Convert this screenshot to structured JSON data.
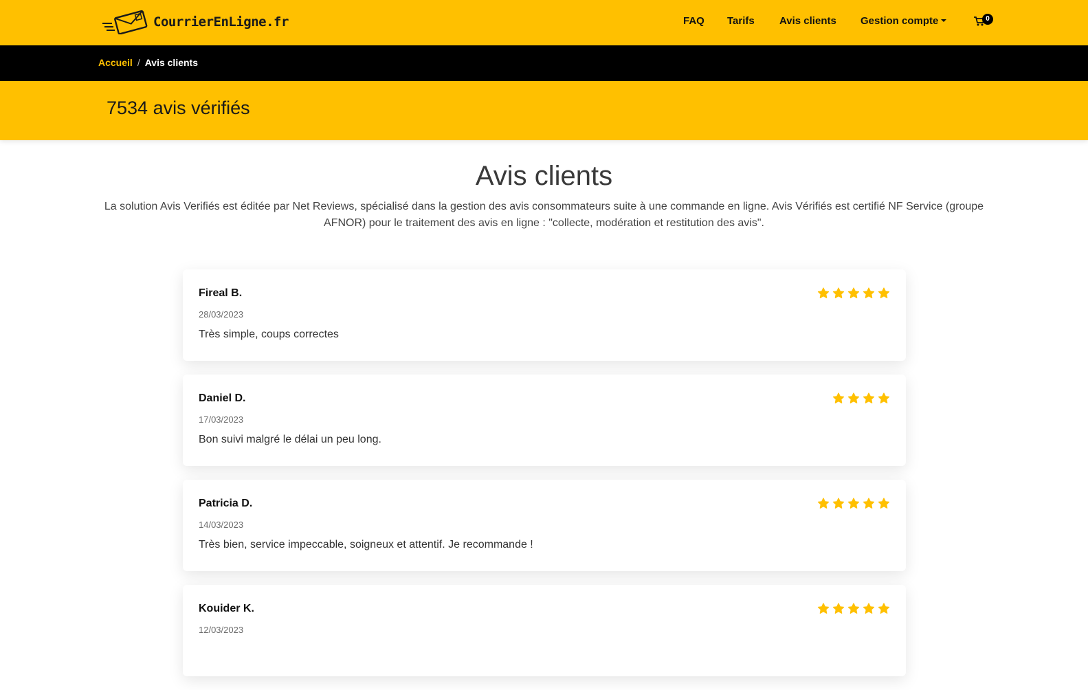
{
  "brand": {
    "name": "CourrierEnLigne.fr",
    "logo_icon": "envelope-icon"
  },
  "nav": {
    "items": [
      {
        "label": "FAQ"
      },
      {
        "label": "Tarifs"
      },
      {
        "label": "Avis clients"
      },
      {
        "label": "Gestion compte",
        "has_dropdown": true
      }
    ],
    "cart": {
      "icon": "cart-icon",
      "count": "0"
    }
  },
  "breadcrumb": {
    "home": "Accueil",
    "separator": "/",
    "current": "Avis clients"
  },
  "hero": {
    "title": "7534 avis vérifiés"
  },
  "page": {
    "title": "Avis clients",
    "intro": "La solution Avis Verifiés est éditée par Net Reviews, spécialisé dans la gestion des avis consommateurs suite à une commande en ligne. Avis Vérifiés est certifié NF Service (groupe AFNOR) pour le traitement des avis en ligne : \"collecte, modération et restitution des avis\"."
  },
  "reviews": [
    {
      "name": "Fireal B.",
      "date": "28/03/2023",
      "text": "Très simple, coups correctes",
      "rating": 5
    },
    {
      "name": "Daniel D.",
      "date": "17/03/2023",
      "text": "Bon suivi malgré le délai un peu long.",
      "rating": 4
    },
    {
      "name": "Patricia D.",
      "date": "14/03/2023",
      "text": "Très bien, service impeccable, soigneux et attentif. Je recommande !",
      "rating": 5
    },
    {
      "name": "Kouider K.",
      "date": "12/03/2023",
      "text": "",
      "rating": 5
    }
  ],
  "colors": {
    "brand_yellow": "#ffc000",
    "breadcrumb_bg": "#000000",
    "star": "#ffc000"
  }
}
